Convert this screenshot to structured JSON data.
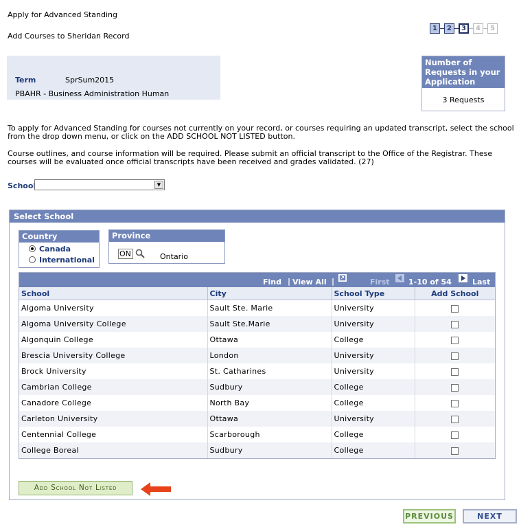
{
  "header": {
    "title": "Apply for Advanced Standing",
    "subtitle": "Add Courses to Sheridan Record",
    "steps": [
      "1",
      "2",
      "3",
      "4",
      "5"
    ],
    "current_step": 3
  },
  "term": {
    "label": "Term",
    "value": "SprSum2015",
    "program": "PBAHR - Business Administration Human"
  },
  "requests": {
    "title": "Number of Requests in your Application",
    "value": "3 Requests"
  },
  "instructions": [
    "To apply for Advanced Standing for courses not currently on your record, or courses requiring an updated transcript, select the school from the drop down menu, or click on the ADD SCHOOL NOT LISTED button.",
    "Course outlines, and course information will be required.  Please submit an official transcript to the Office of the Registrar. These courses will be evaluated once official transcripts have been received and grades validated. (27)"
  ],
  "school_select": {
    "label": "School",
    "value": ""
  },
  "select_school": {
    "title": "Select School",
    "country": {
      "title": "Country",
      "options": [
        "Canada",
        "International"
      ],
      "selected": "Canada"
    },
    "province": {
      "title": "Province",
      "code": "ON",
      "name": "Ontario"
    }
  },
  "grid": {
    "nav": {
      "find": "Find",
      "sep": "|",
      "view_all": "View All",
      "first": "First",
      "range": "1-10 of 54",
      "last": "Last"
    },
    "columns": [
      "School",
      "City",
      "School Type",
      "Add School"
    ],
    "rows": [
      {
        "school": "Algoma University",
        "city": "Sault Ste. Marie",
        "type": "University"
      },
      {
        "school": "Algoma University College",
        "city": "Sault Ste.Marie",
        "type": "University"
      },
      {
        "school": "Algonquin College",
        "city": "Ottawa",
        "type": "College"
      },
      {
        "school": "Brescia University College",
        "city": "London",
        "type": "University"
      },
      {
        "school": "Brock University",
        "city": "St. Catharines",
        "type": "University"
      },
      {
        "school": "Cambrian College",
        "city": "Sudbury",
        "type": "College"
      },
      {
        "school": "Canadore College",
        "city": "North Bay",
        "type": "College"
      },
      {
        "school": "Carleton University",
        "city": "Ottawa",
        "type": "University"
      },
      {
        "school": "Centennial College",
        "city": "Scarborough",
        "type": "College"
      },
      {
        "school": "College Boreal",
        "city": "Sudbury",
        "type": "College"
      }
    ]
  },
  "buttons": {
    "add_school": "Add School Not Listed",
    "previous": "PREVIOUS",
    "next": "NEXT"
  },
  "colors": {
    "header_blue": "#6f84b8",
    "label_blue": "#1c3a7a",
    "arrow_red": "#e8421a",
    "button_green": "#dfeec8"
  }
}
